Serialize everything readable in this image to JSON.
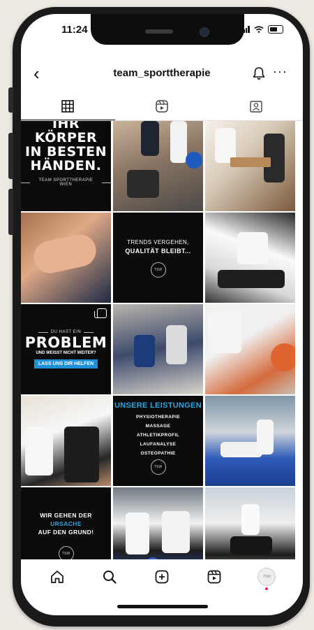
{
  "status_bar": {
    "time": "11:24"
  },
  "header": {
    "username": "team_sporttherapie"
  },
  "tabs": [
    {
      "name": "grid",
      "icon": "grid-icon",
      "active": true
    },
    {
      "name": "reels",
      "icon": "reels-icon",
      "active": false
    },
    {
      "name": "tagged",
      "icon": "tagged-icon",
      "active": false
    }
  ],
  "posts": {
    "p1": {
      "line1": "IHR KÖRPER",
      "line2": "IN BESTEN",
      "line3": "HÄNDEN.",
      "footer": "TEAM SPORTTHERAPIE WIEN"
    },
    "p5": {
      "line1": "TRENDS VERGEHEN,",
      "line2": "QUALITÄT BLEIBT..."
    },
    "p7": {
      "line1": "DU HAST EIN",
      "line2": "PROBLEM",
      "line3": "UND WEISST NICHT WEITER?",
      "button": "LASS UNS DIR HELFEN"
    },
    "p11": {
      "title": "UNSERE LEISTUNGEN",
      "items": [
        "PHYSIOTHERAPIE",
        "MASSAGE",
        "ATHLETIKPROFIL",
        "LAUFANALYSE",
        "OSTEOPATHIE"
      ]
    },
    "p13": {
      "line1": "WIR GEHEN DER",
      "line2": "URSACHE",
      "line3": "AUF DEN GRUND!"
    }
  },
  "colors": {
    "accent_blue": "#29a7e8",
    "dark_post": "#0b0b0b",
    "notification_dot": "#e0245e"
  },
  "bottom_nav": [
    "home-icon",
    "search-icon",
    "create-icon",
    "reels-icon",
    "profile-avatar"
  ]
}
